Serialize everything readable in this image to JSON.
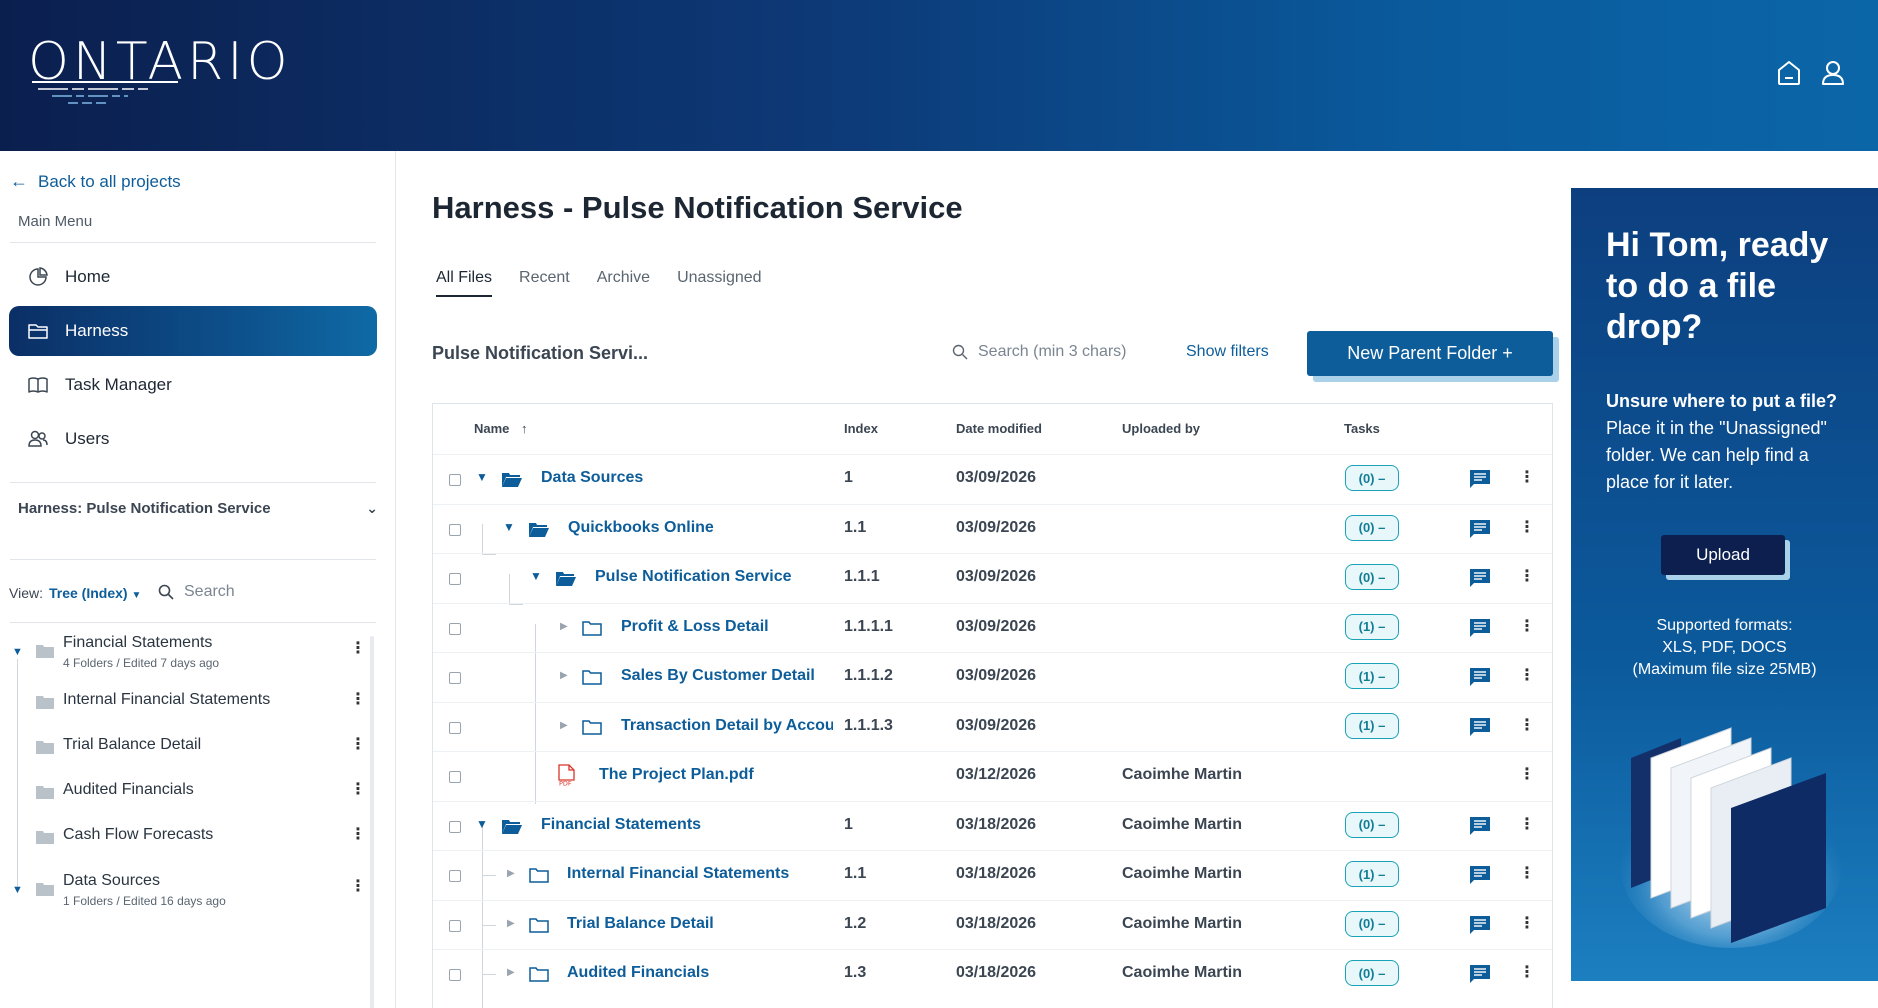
{
  "header": {
    "logo_text": "ONTARIO",
    "icons": [
      "home-icon",
      "user-icon"
    ]
  },
  "sidebar": {
    "back_label": "Back to all projects",
    "main_menu_label": "Main Menu",
    "nav": [
      {
        "label": "Home",
        "icon": "dashboard-icon"
      },
      {
        "label": "Harness",
        "icon": "folder-icon",
        "active": true
      },
      {
        "label": "Task Manager",
        "icon": "book-icon"
      },
      {
        "label": "Users",
        "icon": "users-icon"
      }
    ],
    "project_label": "Harness: Pulse Notification Service",
    "view_label": "View:",
    "view_value": "Tree (Index)",
    "search_placeholder": "Search",
    "tree": [
      {
        "title": "Financial Statements",
        "sub": "4 Folders / Edited 7 days ago"
      },
      {
        "title": "Internal Financial Statements"
      },
      {
        "title": "Trial Balance Detail"
      },
      {
        "title": "Audited Financials"
      },
      {
        "title": "Cash Flow Forecasts"
      },
      {
        "title": "Data Sources",
        "sub": "1 Folders / Edited 16 days ago"
      }
    ]
  },
  "main": {
    "title": "Harness - Pulse Notification Service",
    "tabs": [
      "All Files",
      "Recent",
      "Archive",
      "Unassigned"
    ],
    "crumb": "Pulse Notification Servi...",
    "search_placeholder": "Search (min 3 chars)",
    "show_filters": "Show filters",
    "new_folder_label": "New Parent Folder +",
    "columns": {
      "name": "Name",
      "index": "Index",
      "date": "Date modified",
      "uploaded": "Uploaded by",
      "tasks": "Tasks"
    },
    "rows": [
      {
        "name": "Data Sources",
        "index": "1",
        "date": "03/09/2026",
        "uploaded": "",
        "tasks": "(0) –"
      },
      {
        "name": "Quickbooks Online",
        "index": "1.1",
        "date": "03/09/2026",
        "uploaded": "",
        "tasks": "(0) –"
      },
      {
        "name": "Pulse Notification Service",
        "index": "1.1.1",
        "date": "03/09/2026",
        "uploaded": "",
        "tasks": "(0) –"
      },
      {
        "name": "Profit & Loss Detail",
        "index": "1.1.1.1",
        "date": "03/09/2026",
        "uploaded": "",
        "tasks": "(1) –"
      },
      {
        "name": "Sales By Customer Detail",
        "index": "1.1.1.2",
        "date": "03/09/2026",
        "uploaded": "",
        "tasks": "(1) –"
      },
      {
        "name": "Transaction Detail by Accou",
        "index": "1.1.1.3",
        "date": "03/09/2026",
        "uploaded": "",
        "tasks": "(1) –"
      },
      {
        "name": "The Project Plan.pdf",
        "index": "",
        "date": "03/12/2026",
        "uploaded": "Caoimhe Martin",
        "tasks": ""
      },
      {
        "name": "Financial Statements",
        "index": "1",
        "date": "03/18/2026",
        "uploaded": "Caoimhe Martin",
        "tasks": "(0) –"
      },
      {
        "name": "Internal Financial Statements",
        "index": "1.1",
        "date": "03/18/2026",
        "uploaded": "Caoimhe Martin",
        "tasks": "(1) –"
      },
      {
        "name": "Trial Balance Detail",
        "index": "1.2",
        "date": "03/18/2026",
        "uploaded": "Caoimhe Martin",
        "tasks": "(0) –"
      },
      {
        "name": "Audited Financials",
        "index": "1.3",
        "date": "03/18/2026",
        "uploaded": "Caoimhe Martin",
        "tasks": "(0) –"
      }
    ]
  },
  "promo": {
    "title": "Hi Tom, ready to do a file drop?",
    "sub_bold": "Unsure where to put a file?",
    "sub_text": "Place it in the \"Unassigned\" folder. We can help find a place for it later.",
    "upload_label": "Upload",
    "formats_line1": "Supported formats:",
    "formats_line2": "XLS, PDF, DOCS",
    "formats_line3": "(Maximum file size 25MB)"
  },
  "colors": {
    "accent": "#0d5d9a",
    "header_dark": "#0b1f4e",
    "badge": "#1aa3b8",
    "pdf": "#d9342b"
  }
}
